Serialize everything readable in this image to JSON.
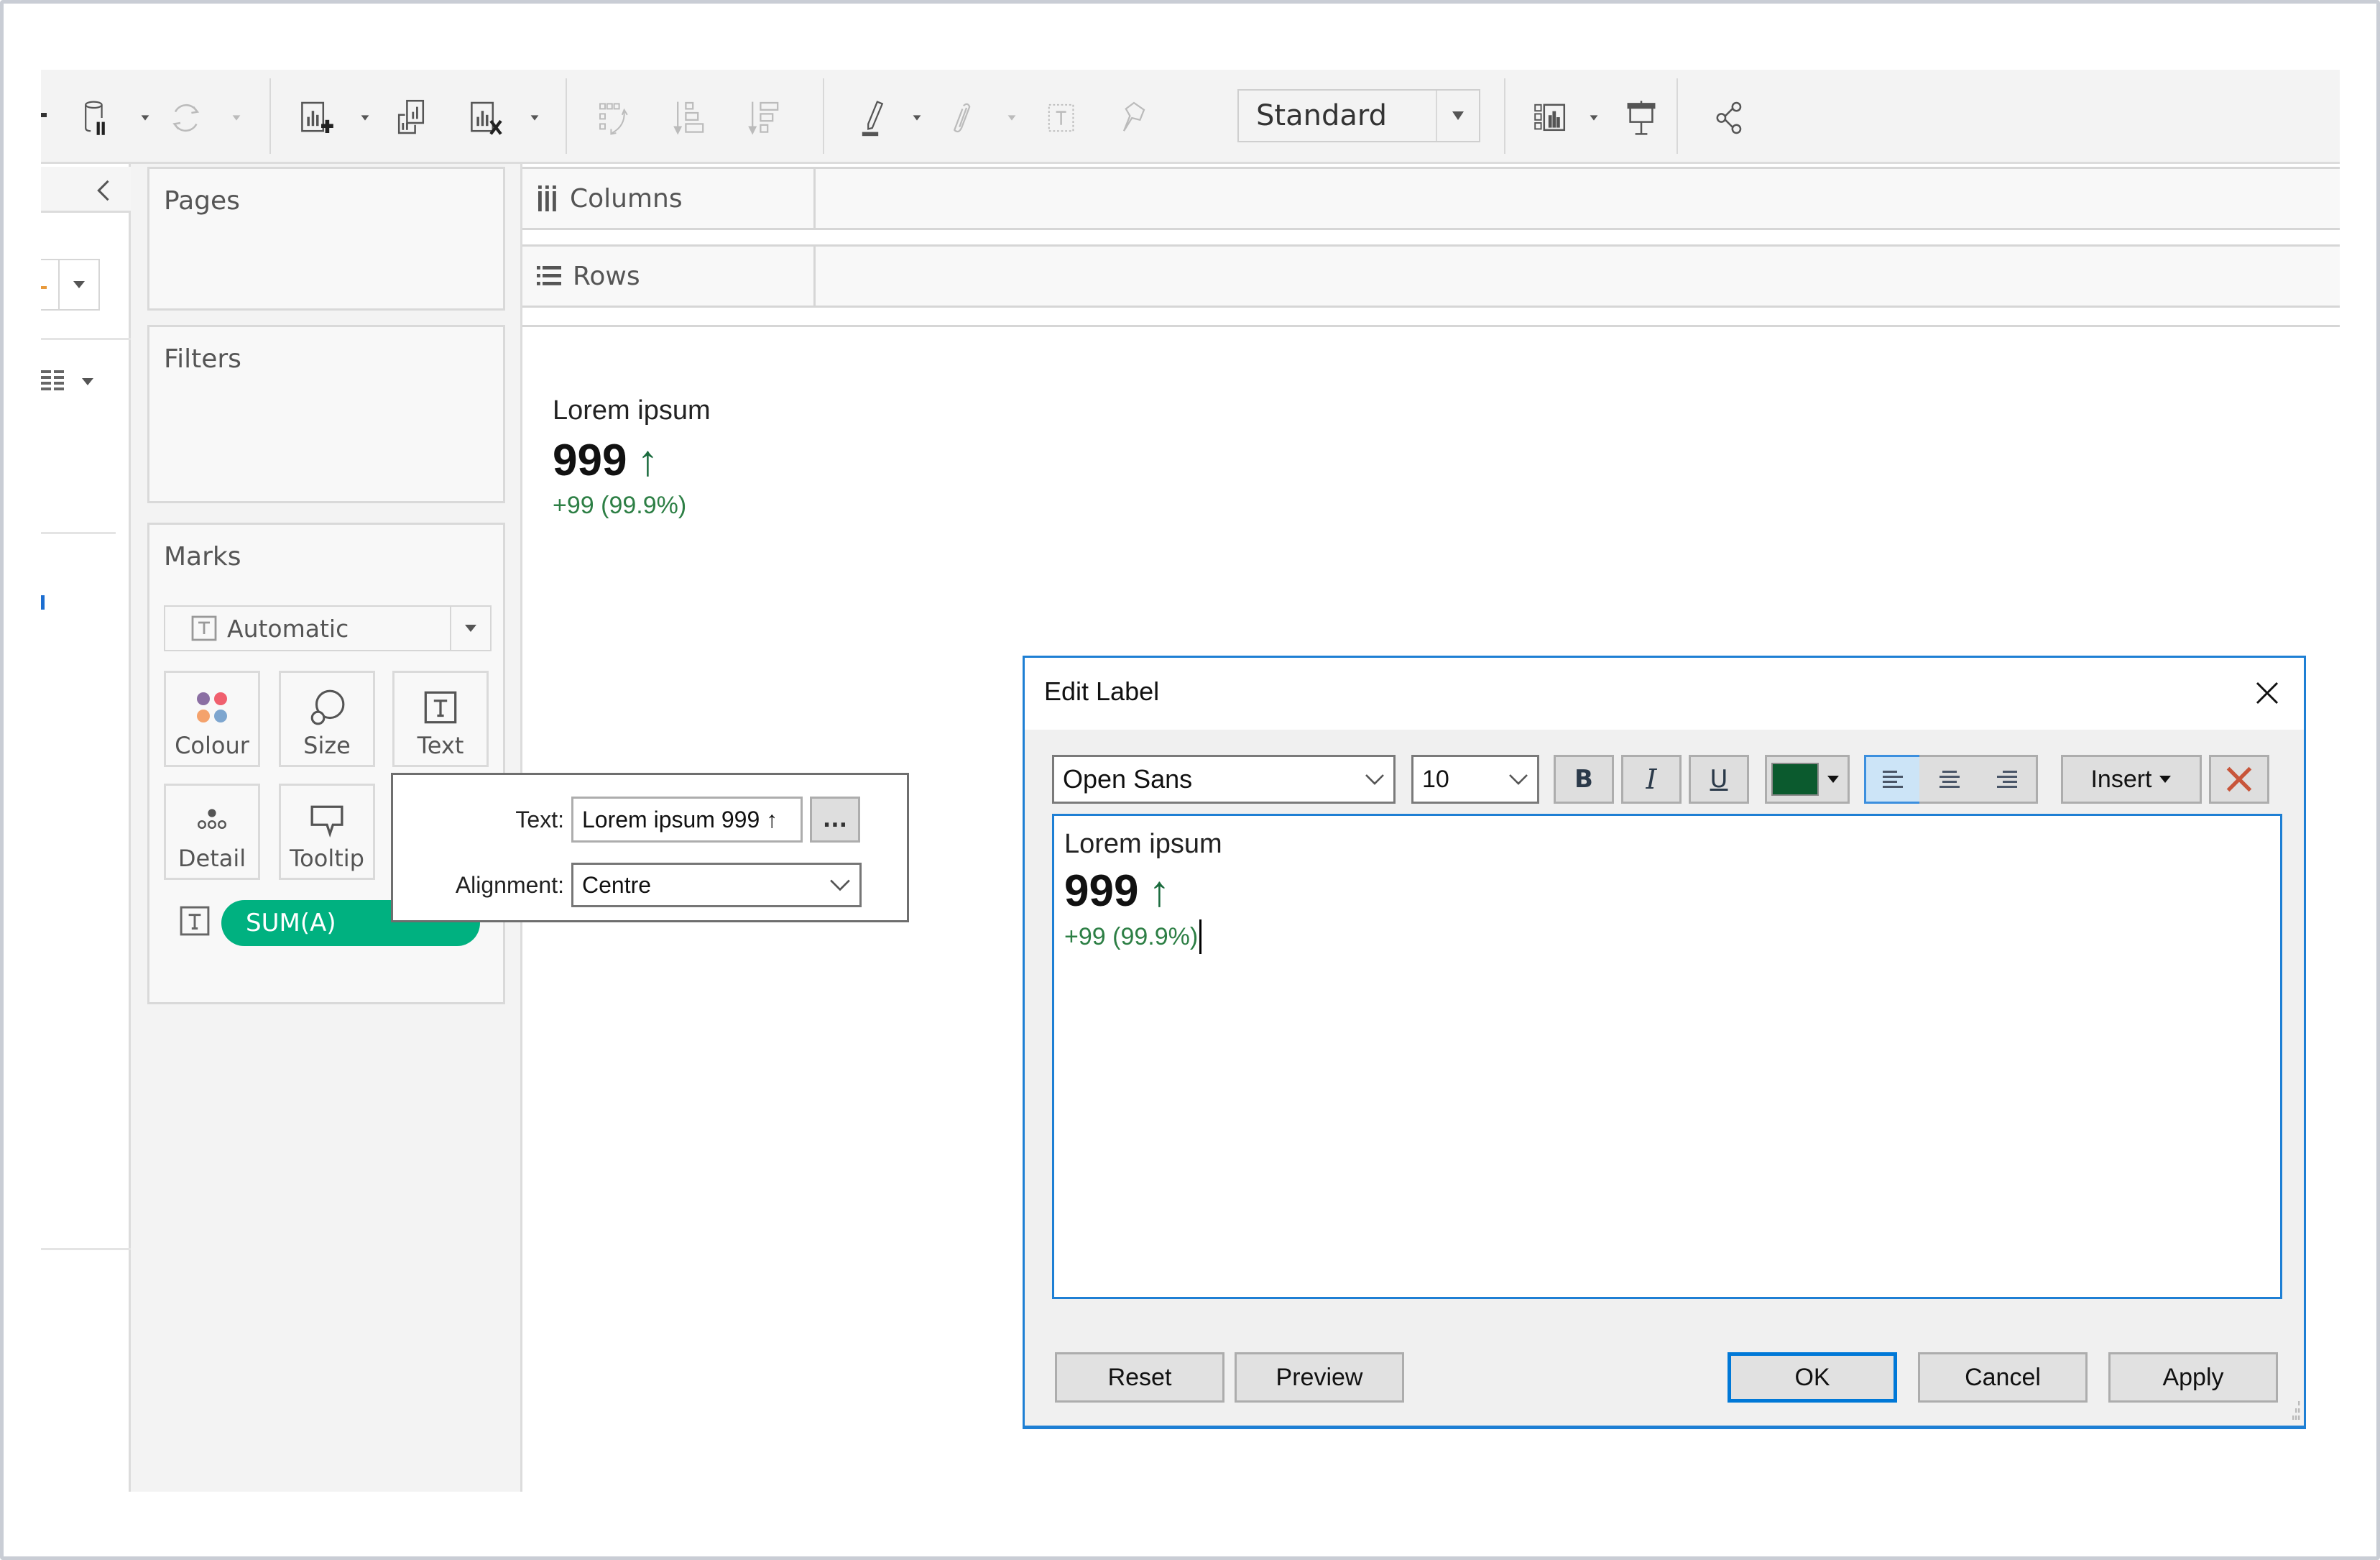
{
  "toolbar": {
    "icons": [
      {
        "name": "pause-auto-updates-icon"
      },
      {
        "name": "refresh-icon"
      },
      {
        "name": "new-worksheet-icon"
      },
      {
        "name": "duplicate-worksheet-icon"
      },
      {
        "name": "clear-worksheet-icon"
      },
      {
        "name": "swap-rows-columns-icon"
      },
      {
        "name": "sort-ascending-icon"
      },
      {
        "name": "sort-descending-icon"
      },
      {
        "name": "highlight-icon"
      },
      {
        "name": "group-members-icon"
      },
      {
        "name": "show-mark-labels-icon"
      },
      {
        "name": "fix-axes-icon"
      },
      {
        "name": "show-me-icon"
      },
      {
        "name": "presentation-mode-icon"
      },
      {
        "name": "share-icon"
      }
    ],
    "fit_select": "Standard"
  },
  "shelves": {
    "pages": "Pages",
    "filters": "Filters",
    "marks": "Marks",
    "columns": "Columns",
    "rows": "Rows"
  },
  "marks": {
    "type": "Automatic",
    "buttons": {
      "colour": "Colour",
      "size": "Size",
      "text": "Text",
      "detail": "Detail",
      "tooltip": "Tooltip"
    },
    "pill": "SUM(A)",
    "colour_dots": [
      "#8b6fa3",
      "#f0606e",
      "#f4a26c",
      "#7ea6cf"
    ]
  },
  "viz": {
    "title": "Lorem ipsum",
    "value": "999",
    "arrow": "↑",
    "change": "+99 (99.9%)",
    "green": "#2d7f45"
  },
  "text_popup": {
    "text_label": "Text:",
    "text_value": "Lorem ipsum 999 ↑",
    "more_button": "...",
    "alignment_label": "Alignment:",
    "alignment_value": "Centre"
  },
  "edit_label": {
    "title": "Edit Label",
    "font": "Open Sans",
    "size": "10",
    "bold": "B",
    "italic": "I",
    "underline": "U",
    "font_color": "#0b5a2e",
    "insert": "Insert",
    "content": {
      "line1": "Lorem ipsum",
      "line2_value": "999",
      "line2_arrow": "↑",
      "line3": "+99 (99.9%)"
    },
    "buttons": {
      "reset": "Reset",
      "preview": "Preview",
      "ok": "OK",
      "cancel": "Cancel",
      "apply": "Apply"
    }
  }
}
